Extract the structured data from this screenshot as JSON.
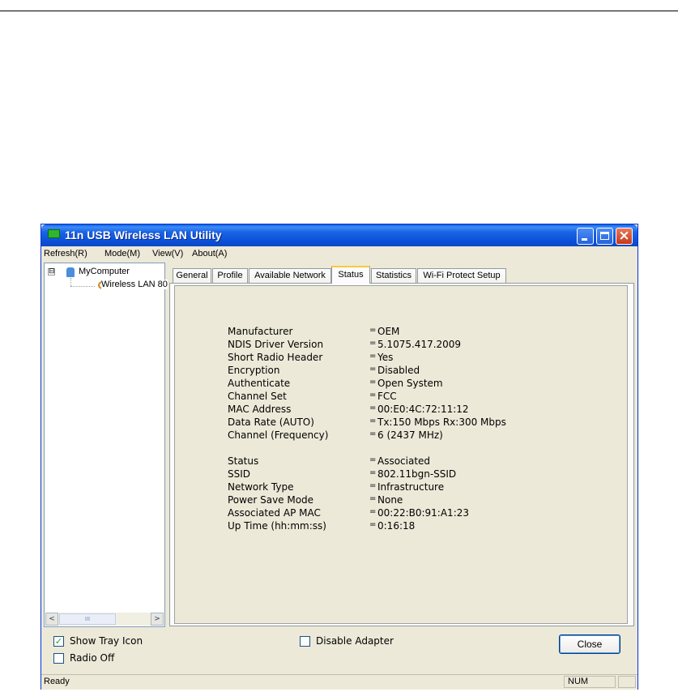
{
  "window": {
    "title": "11n USB Wireless LAN Utility"
  },
  "menu": [
    "Refresh(R)",
    "Mode(M)",
    "View(V)",
    "About(A)"
  ],
  "tree": {
    "root": "MyComputer",
    "child": "Wireless LAN 80",
    "expand_symbol": "⊟"
  },
  "tabs": [
    "General",
    "Profile",
    "Available Network",
    "Status",
    "Statistics",
    "Wi-Fi Protect Setup"
  ],
  "active_tab": "Status",
  "status": {
    "sep": "=",
    "rows": [
      {
        "label": "Manufacturer",
        "value": "OEM"
      },
      {
        "label": "NDIS Driver Version",
        "value": "5.1075.417.2009"
      },
      {
        "label": "Short Radio Header",
        "value": "Yes"
      },
      {
        "label": "Encryption",
        "value": "Disabled"
      },
      {
        "label": "Authenticate",
        "value": "Open System"
      },
      {
        "label": "Channel Set",
        "value": "FCC"
      },
      {
        "label": "MAC Address",
        "value": "00:E0:4C:72:11:12"
      },
      {
        "label": "Data Rate (AUTO)",
        "value": "Tx:150 Mbps Rx:300 Mbps"
      },
      {
        "label": "Channel (Frequency)",
        "value": "6 (2437 MHz)"
      },
      {
        "label": "Status",
        "value": "Associated"
      },
      {
        "label": "SSID",
        "value": "802.11bgn-SSID"
      },
      {
        "label": "Network Type",
        "value": "Infrastructure"
      },
      {
        "label": "Power Save Mode",
        "value": "None"
      },
      {
        "label": "Associated AP MAC",
        "value": "00:22:B0:91:A1:23"
      },
      {
        "label": "Up Time (hh:mm:ss)",
        "value": "0:16:18"
      }
    ]
  },
  "options": {
    "show_tray_icon": {
      "label": "Show Tray Icon",
      "checked": true,
      "mark": "✓"
    },
    "radio_off": {
      "label": "Radio Off",
      "checked": false
    },
    "disable_adapter": {
      "label": "Disable Adapter",
      "checked": false
    }
  },
  "buttons": {
    "close": "Close"
  },
  "statusbar": {
    "text": "Ready",
    "num": "NUM"
  },
  "scroll": {
    "left": "<",
    "right": ">",
    "thumb": "III"
  }
}
